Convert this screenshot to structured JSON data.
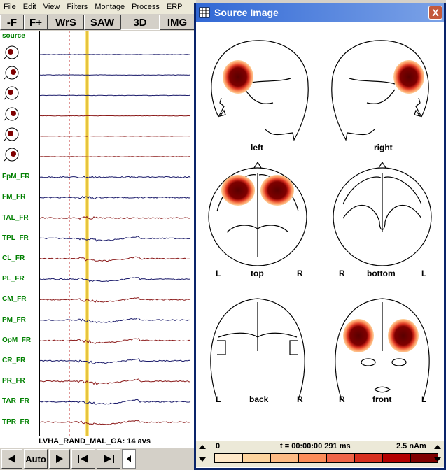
{
  "menu": [
    "File",
    "Edit",
    "View",
    "Filters",
    "Montage",
    "Process",
    "ERP"
  ],
  "toolbar": {
    "buttons": [
      "-F",
      "F+",
      "WrS",
      "SAW",
      "3D",
      "IMG"
    ]
  },
  "channels": {
    "source_label": "source",
    "labels": [
      "FpM_FR",
      "FM_FR",
      "TAL_FR",
      "TPL_FR",
      "CL_FR",
      "PL_FR",
      "CM_FR",
      "PM_FR",
      "OpM_FR",
      "CR_FR",
      "PR_FR",
      "TAR_FR",
      "TPR_FR"
    ]
  },
  "caption": "LVHA_RAND_MAL_GA: 14 avs",
  "bottom": {
    "auto_label": "Auto"
  },
  "window": {
    "title": "Source Image",
    "close": "X"
  },
  "views": {
    "left": "left",
    "right": "right",
    "top": "top",
    "bottom": "bottom",
    "back": "back",
    "front": "front",
    "L": "L",
    "R": "R"
  },
  "scale": {
    "min": "0",
    "time": "t = 00:00:00  291 ms",
    "max": "2.5 nAm",
    "colors": [
      "#fee8c8",
      "#fdd49e",
      "#fdbb84",
      "#fc8d59",
      "#ef6548",
      "#d7301f",
      "#b30000",
      "#7f0000"
    ]
  }
}
